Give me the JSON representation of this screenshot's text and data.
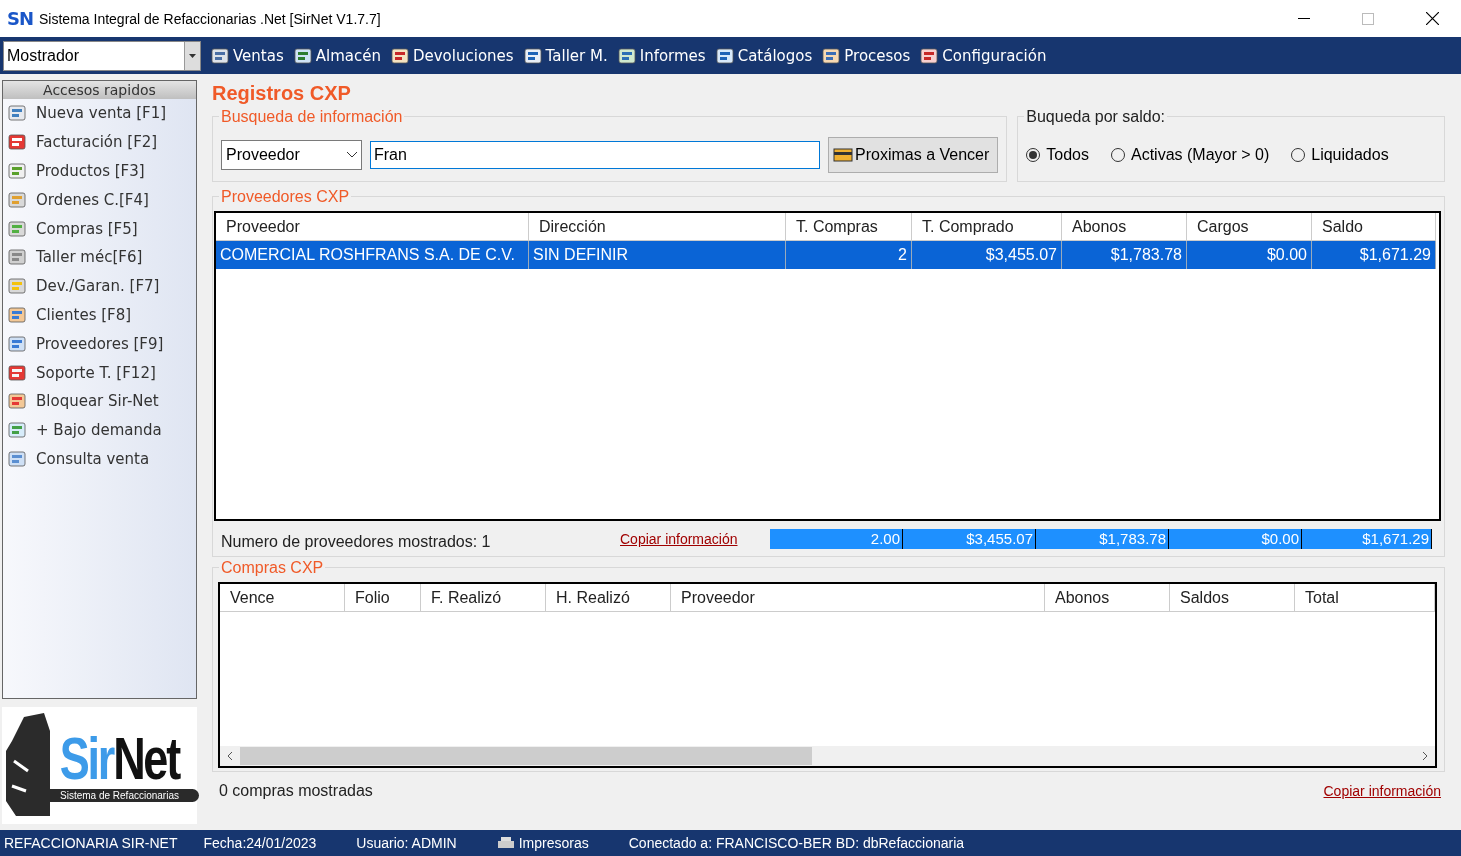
{
  "window": {
    "app_icon_text": "SN",
    "title": "Sistema Integral de Refaccionarias .Net [SirNet V1.7.7]"
  },
  "menu_bar": {
    "location": "Mostrador",
    "items": [
      {
        "label": "Ventas"
      },
      {
        "label": "Almacén"
      },
      {
        "label": "Devoluciones"
      },
      {
        "label": "Taller M."
      },
      {
        "label": "Informes"
      },
      {
        "label": "Catálogos"
      },
      {
        "label": "Procesos"
      },
      {
        "label": "Configuración"
      }
    ]
  },
  "sidebar": {
    "title": "Accesos rapidos",
    "items": [
      {
        "label": "Nueva venta [F1]"
      },
      {
        "label": "Facturación [F2]"
      },
      {
        "label": "Productos [F3]"
      },
      {
        "label": "Ordenes C.[F4]"
      },
      {
        "label": "Compras [F5]"
      },
      {
        "label": "Taller méc[F6]"
      },
      {
        "label": "Dev./Garan. [F7]"
      },
      {
        "label": "Clientes [F8]"
      },
      {
        "label": "Proveedores [F9]"
      },
      {
        "label": "Soporte T. [F12]"
      },
      {
        "label": "Bloquear Sir-Net"
      },
      {
        "label": "+ Bajo demanda"
      },
      {
        "label": "Consulta venta"
      }
    ],
    "logo": {
      "name_first": "Sir",
      "name_second": "Net",
      "tagline": "Sistema de Refaccionarias"
    }
  },
  "main": {
    "heading": "Registros CXP",
    "search": {
      "legend": "Busqueda de información",
      "field": "Proveedor",
      "query": "Fran",
      "button": "Proximas a Vencer"
    },
    "balance_filter": {
      "legend": "Buqueda por saldo:",
      "options": [
        {
          "label": "Todos",
          "selected": true
        },
        {
          "label": "Activas (Mayor > 0)",
          "selected": false
        },
        {
          "label": "Liquidados",
          "selected": false
        }
      ]
    },
    "providers": {
      "legend": "Proveedores CXP",
      "columns": [
        "Proveedor",
        "Dirección",
        "T. Compras",
        "T. Comprado",
        "Abonos",
        "Cargos",
        "Saldo"
      ],
      "rows": [
        {
          "cells": [
            "COMERCIAL ROSHFRANS S.A. DE C.V.",
            "SIN DEFINIR",
            "2",
            "$3,455.07",
            "$1,783.78",
            "$0.00",
            "$1,671.29"
          ],
          "selected": true
        }
      ],
      "count": "Numero de proveedores mostrados: 1",
      "copy_link": "Copiar información",
      "totals": [
        "2.00",
        "$3,455.07",
        "$1,783.78",
        "$0.00",
        "$1,671.29"
      ]
    },
    "purchases": {
      "legend": "Compras CXP",
      "columns": [
        "Vence",
        "Folio",
        "F. Realizó",
        "H. Realizó",
        "Proveedor",
        "Abonos",
        "Saldos",
        "Total"
      ],
      "count": "0 compras mostradas",
      "copy_link": "Copiar información"
    }
  },
  "status_bar": {
    "company": "REFACCIONARIA SIR-NET",
    "date": "Fecha:24/01/2023",
    "user": "Usuario: ADMIN",
    "printers": "Impresoras",
    "connection": "Conectado a: FRANCISCO-BER BD: dbRefaccionaria"
  }
}
